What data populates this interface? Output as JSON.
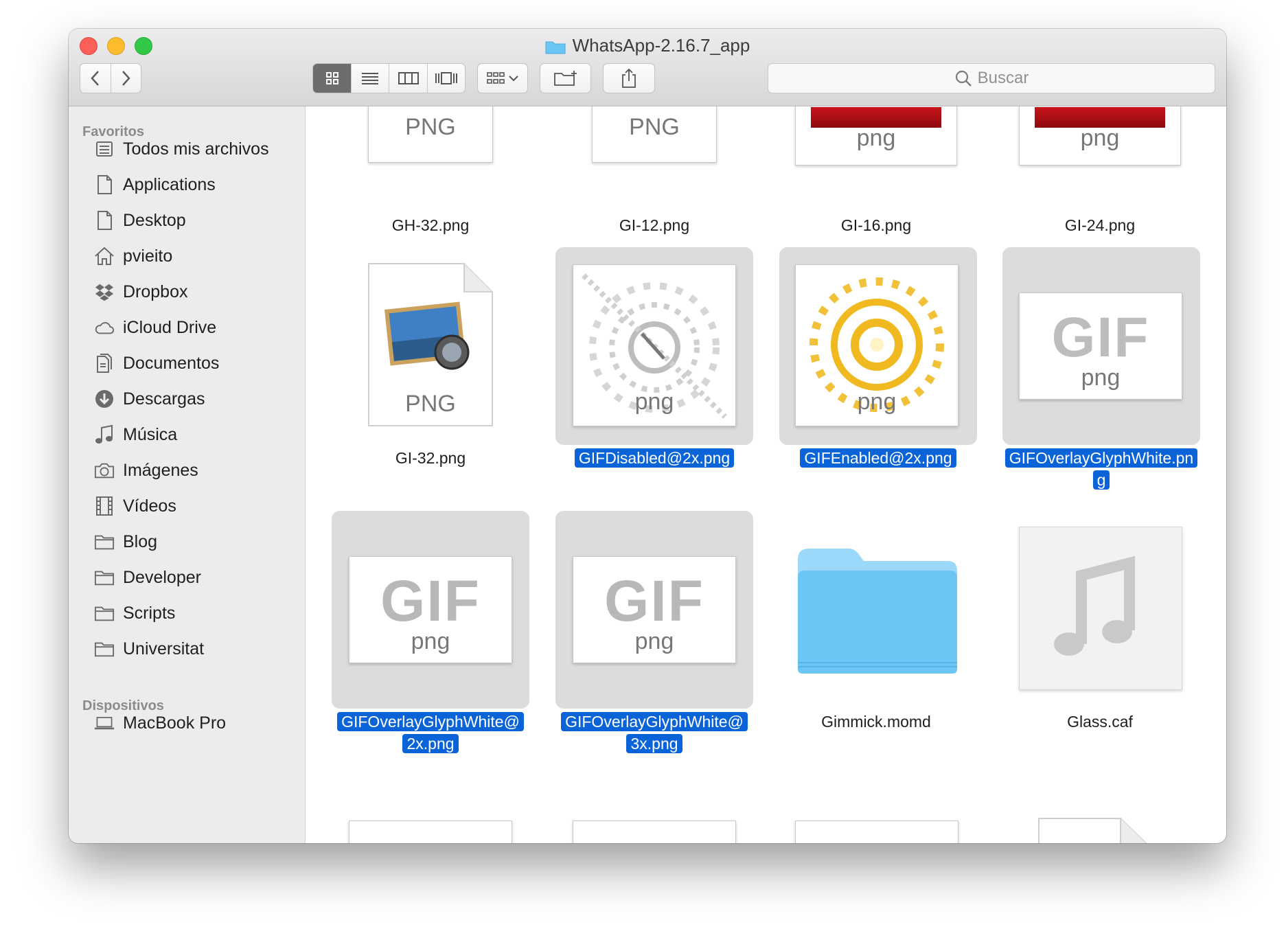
{
  "window": {
    "title": "WhatsApp-2.16.7_app"
  },
  "toolbar": {
    "search_placeholder": "Buscar"
  },
  "sidebar": {
    "favorites_header": "Favoritos",
    "items": [
      {
        "label": "Todos mis archivos",
        "icon": "all-files-icon"
      },
      {
        "label": "Applications",
        "icon": "document-icon"
      },
      {
        "label": "Desktop",
        "icon": "document-icon"
      },
      {
        "label": "pvieito",
        "icon": "home-icon"
      },
      {
        "label": "Dropbox",
        "icon": "dropbox-icon"
      },
      {
        "label": "iCloud Drive",
        "icon": "cloud-icon"
      },
      {
        "label": "Documentos",
        "icon": "documents-icon"
      },
      {
        "label": "Descargas",
        "icon": "download-icon"
      },
      {
        "label": "Música",
        "icon": "music-icon"
      },
      {
        "label": "Imágenes",
        "icon": "camera-icon"
      },
      {
        "label": "Vídeos",
        "icon": "film-icon"
      },
      {
        "label": "Blog",
        "icon": "folder-icon"
      },
      {
        "label": "Developer",
        "icon": "folder-icon"
      },
      {
        "label": "Scripts",
        "icon": "folder-icon"
      },
      {
        "label": "Universitat",
        "icon": "folder-icon"
      }
    ],
    "devices_header": "Dispositivos",
    "devices": [
      {
        "label": "MacBook Pro",
        "icon": "laptop-icon"
      }
    ]
  },
  "files": {
    "row1": [
      {
        "name": "GH-32.png",
        "badge": "PNG"
      },
      {
        "name": "GI-12.png",
        "badge": "PNG"
      },
      {
        "name": "GI-16.png",
        "badge": "png"
      },
      {
        "name": "GI-24.png",
        "badge": "png"
      }
    ],
    "row2": [
      {
        "name": "GI-32.png",
        "badge": "PNG",
        "selected": false
      },
      {
        "name": "GIFDisabled@2x.png",
        "badge": "png",
        "selected": true
      },
      {
        "name": "GIFEnabled@2x.png",
        "badge": "png",
        "selected": true
      },
      {
        "name_line1": "GIFOverlayGlyphWhite.pn",
        "name_line2": "g",
        "badge": "png",
        "gif_text": "GIF",
        "selected": true
      }
    ],
    "row3": [
      {
        "name_line1": "GIFOverlayGlyphWhite@",
        "name_line2": "2x.png",
        "badge": "png",
        "gif_text": "GIF",
        "selected": true
      },
      {
        "name_line1": "GIFOverlayGlyphWhite@",
        "name_line2": "3x.png",
        "badge": "png",
        "gif_text": "GIF",
        "selected": true
      },
      {
        "name": "Gimmick.momd",
        "selected": false
      },
      {
        "name": "Glass.caf",
        "selected": false
      }
    ]
  },
  "colors": {
    "selection": "#0a64d8",
    "folder": "#6cc6f5"
  }
}
